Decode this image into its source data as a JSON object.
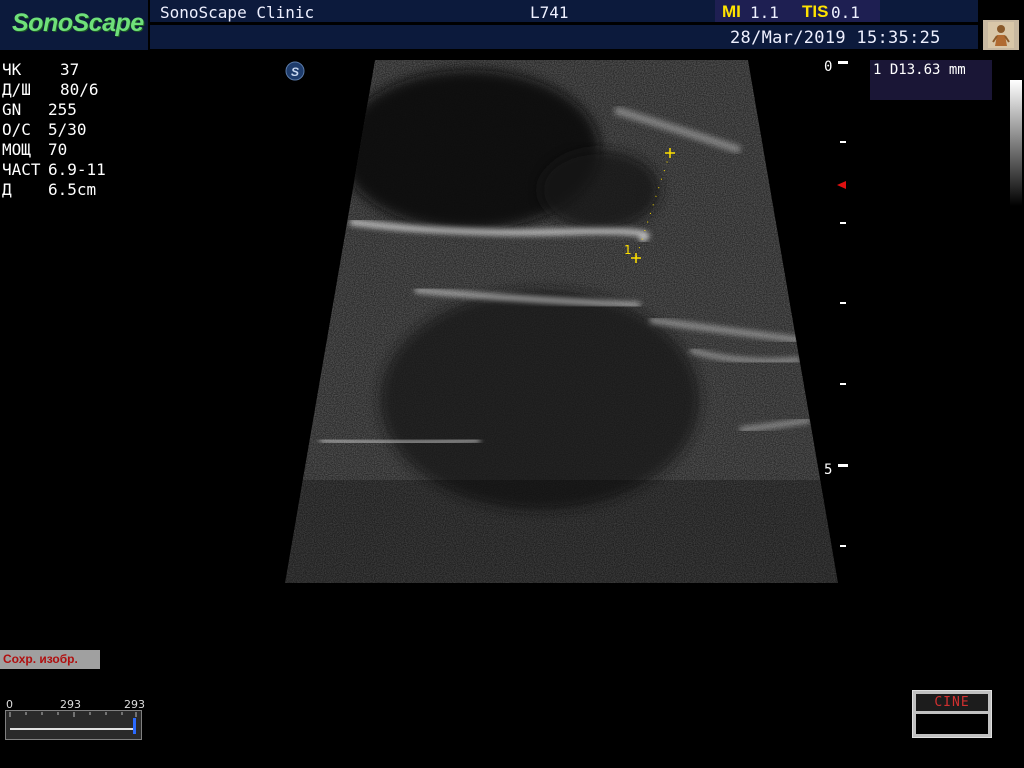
{
  "header": {
    "logo": "SonoScape",
    "clinic": "SonoScape Clinic",
    "probe": "L741",
    "mi_label": "MI",
    "mi_value": "1.1",
    "tis_label": "TIS",
    "tis_value": "0.1",
    "datetime": "28/Mar/2019 15:35:25"
  },
  "params": [
    {
      "label": "ЧК",
      "value": "37"
    },
    {
      "label": "Д/Ш",
      "value": "80/6"
    },
    {
      "label": "GN",
      "value": "255"
    },
    {
      "label": "О/С",
      "value": "5/30"
    },
    {
      "label": "МОЩ",
      "value": "70"
    },
    {
      "label": "ЧАСТ",
      "value": "6.9-11"
    },
    {
      "label": "Д",
      "value": "6.5cm"
    }
  ],
  "depth_scale": {
    "top_label": "0",
    "mid_label": "5"
  },
  "measurement": {
    "text": "1 D13.63 mm",
    "caliper_label": "1"
  },
  "save_button": "Сохр. изобр.",
  "cine_slider": {
    "start": "0",
    "current": "293",
    "end": "293"
  },
  "cine_button": "CINE",
  "colors": {
    "logo_green": "#6fe07a",
    "header_blue": "#0c1a3c",
    "mi_yellow": "#ffe300",
    "caliper_yellow": "#ffe000",
    "save_text_red": "#b01010",
    "focus_marker_red": "#e01010"
  }
}
